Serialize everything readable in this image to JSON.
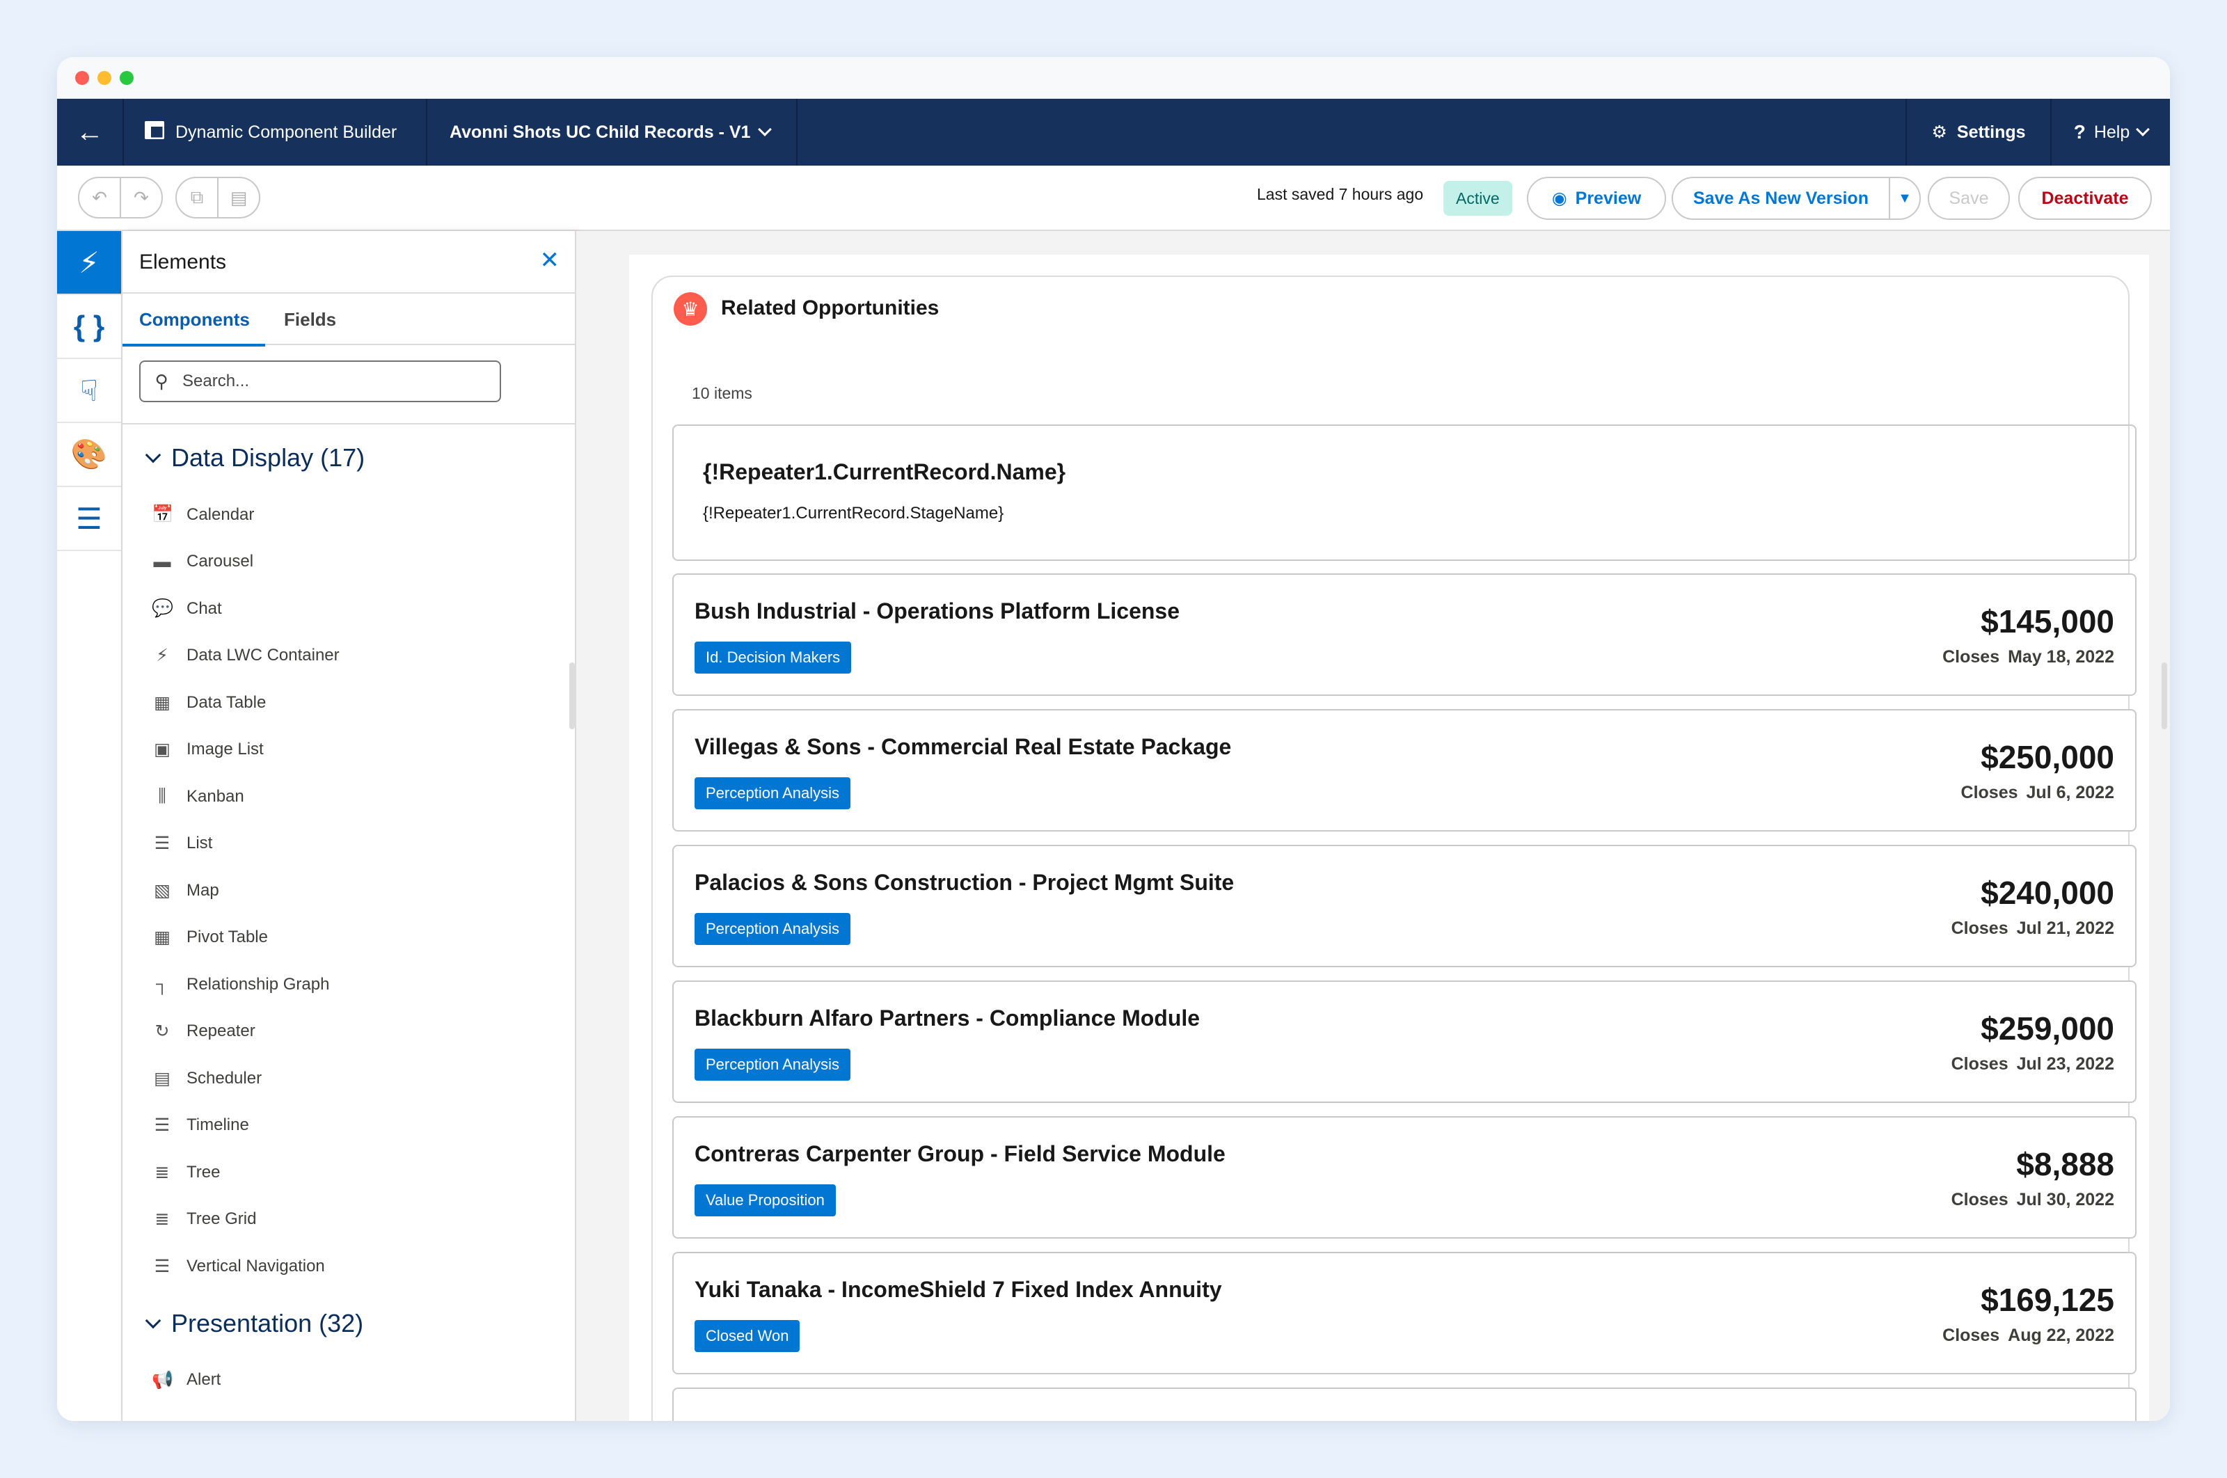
{
  "app": {
    "name": "Dynamic Component Builder",
    "record_title": "Avonni Shots UC Child Records - V1",
    "settings_label": "Settings",
    "help_label": "Help"
  },
  "toolbar": {
    "last_saved": "Last saved 7 hours ago",
    "status": "Active",
    "preview_label": "Preview",
    "save_new_version_label": "Save As New Version",
    "save_label": "Save",
    "deactivate_label": "Deactivate"
  },
  "panel": {
    "title": "Elements",
    "tabs": [
      {
        "label": "Components",
        "active": true
      },
      {
        "label": "Fields",
        "active": false
      }
    ],
    "search_placeholder": "Search...",
    "groups": [
      {
        "label": "Data Display (17)",
        "items": [
          {
            "label": "Calendar",
            "icon": "calendar-icon"
          },
          {
            "label": "Carousel",
            "icon": "carousel-icon"
          },
          {
            "label": "Chat",
            "icon": "chat-icon"
          },
          {
            "label": "Data LWC Container",
            "icon": "bolt-icon"
          },
          {
            "label": "Data Table",
            "icon": "table-icon"
          },
          {
            "label": "Image List",
            "icon": "image-icon"
          },
          {
            "label": "Kanban",
            "icon": "kanban-icon"
          },
          {
            "label": "List",
            "icon": "list-icon"
          },
          {
            "label": "Map",
            "icon": "map-icon"
          },
          {
            "label": "Pivot Table",
            "icon": "table-icon"
          },
          {
            "label": "Relationship Graph",
            "icon": "hierarchy-icon"
          },
          {
            "label": "Repeater",
            "icon": "refresh-icon"
          },
          {
            "label": "Scheduler",
            "icon": "scheduler-icon"
          },
          {
            "label": "Timeline",
            "icon": "list-icon"
          },
          {
            "label": "Tree",
            "icon": "tree-icon"
          },
          {
            "label": "Tree Grid",
            "icon": "tree-icon"
          },
          {
            "label": "Vertical Navigation",
            "icon": "list-icon"
          }
        ]
      },
      {
        "label": "Presentation (32)",
        "items": [
          {
            "label": "Alert",
            "icon": "alert-icon"
          }
        ]
      }
    ]
  },
  "card": {
    "title": "Related Opportunities",
    "icon": "crown-icon",
    "items_count": "10 items",
    "template_name": "{!Repeater1.CurrentRecord.Name}",
    "template_stage": "{!Repeater1.CurrentRecord.StageName}",
    "close_prefix": "Closes",
    "records": [
      {
        "name": "Bush Industrial - Operations Platform License",
        "stage": "Id. Decision Makers",
        "amount": "$145,000",
        "close": "May 18, 2022"
      },
      {
        "name": "Villegas & Sons - Commercial Real Estate Package",
        "stage": "Perception Analysis",
        "amount": "$250,000",
        "close": "Jul 6, 2022"
      },
      {
        "name": "Palacios & Sons Construction - Project Mgmt Suite",
        "stage": "Perception Analysis",
        "amount": "$240,000",
        "close": "Jul 21, 2022"
      },
      {
        "name": "Blackburn Alfaro Partners - Compliance Module",
        "stage": "Perception Analysis",
        "amount": "$259,000",
        "close": "Jul 23, 2022"
      },
      {
        "name": "Contreras Carpenter Group - Field Service Module",
        "stage": "Value Proposition",
        "amount": "$8,888",
        "close": "Jul 30, 2022"
      },
      {
        "name": "Yuki Tanaka - IncomeShield 7 Fixed Index Annuity",
        "stage": "Closed Won",
        "amount": "$169,125",
        "close": "Aug 22, 2022"
      }
    ]
  },
  "colors": {
    "nav_bg": "#16325c",
    "brand_blue": "#0176d3",
    "active_badge_bg": "#c3f1ea",
    "danger": "#ba0517",
    "card_icon": "#fe5c4c"
  }
}
